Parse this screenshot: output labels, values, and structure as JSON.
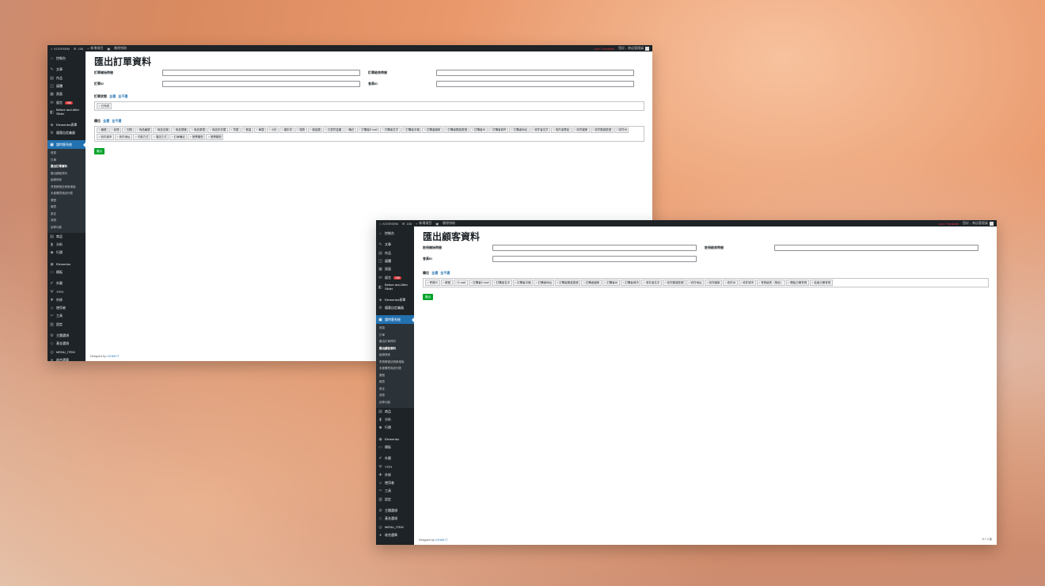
{
  "adminbar": {
    "site": "KOSFARM",
    "comments": "158",
    "new": "新增項目",
    "media": "刪除快取",
    "lang": "Loco Translate",
    "greeting": "您好，商店管理員"
  },
  "sidebar_top": [
    {
      "icon": "⌂",
      "label": "控制台"
    },
    {
      "sep": true
    },
    {
      "icon": "✎",
      "label": "文章"
    },
    {
      "icon": "▤",
      "label": "作品"
    },
    {
      "icon": "◫",
      "label": "媒體"
    },
    {
      "icon": "▦",
      "label": "頁面"
    },
    {
      "icon": "✉",
      "label": "留言",
      "badge": "158"
    },
    {
      "icon": "◧",
      "label": "Before and After Slider",
      "two": true
    },
    {
      "sep": true
    },
    {
      "icon": "◈",
      "label": "Elementor表單"
    },
    {
      "icon": "⚙",
      "label": "優惠自定義器"
    },
    {
      "sep": true
    }
  ],
  "sidebar_current": {
    "icon": "▣",
    "label": "韻特客系統"
  },
  "sidebar_bottom": [
    {
      "icon": "▤",
      "label": "商品"
    },
    {
      "icon": "▮",
      "label": "分析"
    },
    {
      "icon": "◆",
      "label": "行銷"
    },
    {
      "sep": true
    },
    {
      "icon": "◉",
      "label": "Elementor"
    },
    {
      "icon": "▭",
      "label": "模板"
    },
    {
      "sep": true
    },
    {
      "icon": "✐",
      "label": "外觀"
    },
    {
      "icon": "Ψ",
      "label": "YITH"
    },
    {
      "icon": "✚",
      "label": "外掛"
    },
    {
      "icon": "☺",
      "label": "使用者"
    },
    {
      "icon": "✂",
      "label": "工具"
    },
    {
      "icon": "▥",
      "label": "設定"
    },
    {
      "sep": true
    },
    {
      "icon": "⚙",
      "label": "主題選項"
    },
    {
      "icon": "◇",
      "label": "基金選項"
    },
    {
      "icon": "◎",
      "label": "MENU_ITEM"
    },
    {
      "icon": "●",
      "label": "收合選單"
    }
  ],
  "submenu1": [
    "首頁",
    "訂單",
    "匯出訂單資料",
    "匯出顧客資料",
    "組織商家",
    "會員帳號註冊新增版",
    "未被購買商品列表",
    "廣聲",
    "報表",
    "設定",
    "狀態",
    "延伸功能"
  ],
  "submenu1_active": 2,
  "submenu2": [
    "首頁",
    "訂單",
    "匯出訂單資料",
    "匯出顧客資料",
    "組織商家",
    "會員帳號註冊新增版",
    "未被購買商品列表",
    "廣聲",
    "報表",
    "設定",
    "狀態",
    "延伸功能"
  ],
  "submenu2_active": 3,
  "order": {
    "title": "匯出訂單資料",
    "start_label": "訂單開始時間",
    "end_label": "訂單結束時間",
    "id_label": "訂單ID",
    "member_label": "會員ID",
    "status_label": "訂單狀態",
    "select_all": "全選",
    "deselect_all": "全不選",
    "status_tags": [
      "已完成"
    ],
    "fields_label": "欄位",
    "field_tags": [
      "編號",
      "狀態",
      "日期",
      "商品編號",
      "商品名稱",
      "商品規格",
      "商品原價",
      "商品折扣價",
      "貨號",
      "數量",
      "單價",
      "小計",
      "總折扣",
      "運費",
      "總金額",
      "已退貨金額",
      "備註",
      "訂購者E-mail",
      "訂購者名字",
      "訂購者手機",
      "訂購者國家",
      "訂購者郵遞區號",
      "訂購者州",
      "訂購者城市",
      "訂購者地址",
      "收件者名字",
      "收件者電話",
      "收件國家",
      "收件郵遞區號",
      "收件州",
      "收件城市",
      "收件地址",
      "付款方式",
      "運送方式",
      "訂單備註",
      "發票類型",
      "發票類型"
    ],
    "button": "匯出",
    "footer_text": "Designed by ",
    "footer_link": "LOHAS IT"
  },
  "customer": {
    "title": "匯出顧客資料",
    "start_label": "註冊開始時間",
    "end_label": "註冊結束時間",
    "member_label": "會員ID",
    "fields_label": "欄位",
    "select_all": "全選",
    "deselect_all": "全不選",
    "field_tags": [
      "會員ID",
      "帳號",
      "E-mail",
      "訂購者E-mail",
      "訂購者名字",
      "訂購者手機",
      "訂購者地址",
      "訂購者郵遞區號",
      "訂購者國家",
      "訂購者州",
      "訂購者城市",
      "收件者名字",
      "收件郵遞區號",
      "收件地址",
      "收件國家",
      "收件州",
      "收件城市",
      "會員級別（角色）",
      "開始日期會員",
      "結束日期會員"
    ],
    "button": "匯出",
    "footer_text": "Designed by ",
    "footer_link": "LOHAS IT",
    "version": "5.7.2 版"
  }
}
